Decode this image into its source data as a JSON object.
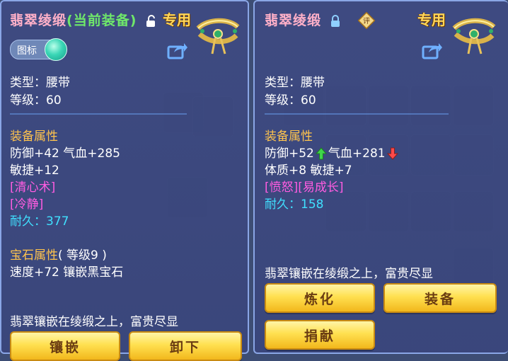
{
  "left": {
    "title_main": "翡翠绫缎",
    "title_paren": "(当前装备)",
    "exclusive": "专用",
    "toggle_label": "图标",
    "type_line": "类型：腰带",
    "level_line": "等级：60",
    "attr_header": "装备属性",
    "attr_line1": "防御+42 气血+285",
    "attr_line2": "敏捷+12",
    "skill1": "[清心术]",
    "skill2": "[冷静]",
    "durability_label": "耐久：",
    "durability_value": "377",
    "gem_header": "宝石属性",
    "gem_level": "( 等级9 )",
    "gem_line": "速度+72 镶嵌黑宝石",
    "flavor": "翡翠镶嵌在绫缎之上，富贵尽显",
    "btn_inlay": "镶嵌",
    "btn_unequip": "卸下"
  },
  "right": {
    "title_main": "翡翠绫缎",
    "badge": "评",
    "exclusive": "专用",
    "type_line": "类型：腰带",
    "level_line": "等级：60",
    "attr_header": "装备属性",
    "attr_def": "防御+52",
    "attr_hp": "气血+281",
    "attr_line2": "体质+8 敏捷+7",
    "skills": "[愤怒][易成长]",
    "durability_label": "耐久：",
    "durability_value": "158",
    "flavor": "翡翠镶嵌在绫缎之上，富贵尽显",
    "btn_refine": "炼化",
    "btn_equip": "装备",
    "btn_donate": "捐献"
  },
  "colors": {
    "title": "#ffb0c8",
    "title_highlight": "#6fe86a",
    "section": "#ffc44d",
    "skill": "#ff5ce1",
    "durability": "#40e0ff",
    "button": "#ffe050"
  }
}
